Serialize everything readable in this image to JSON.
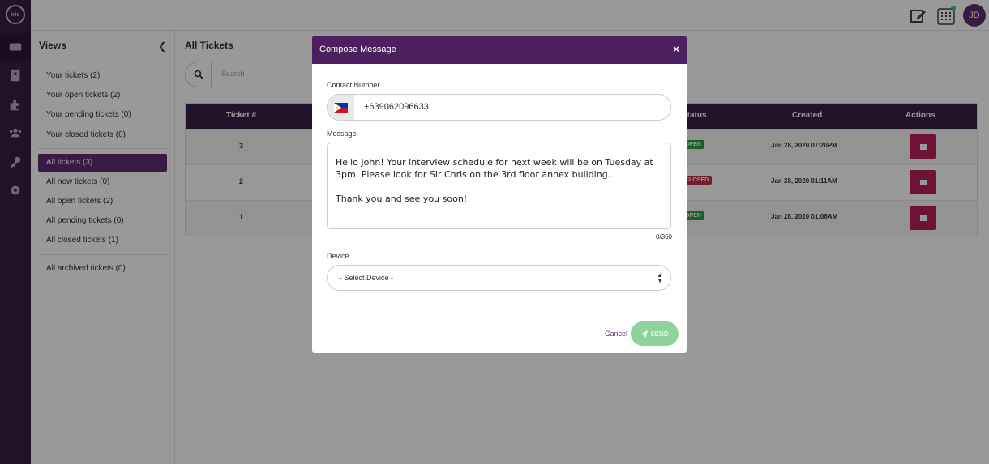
{
  "rail": {
    "logo_text": "iris"
  },
  "topbar": {
    "avatar_initials": "JD"
  },
  "views": {
    "title": "Views",
    "group1": [
      {
        "label": "Your tickets (2)"
      },
      {
        "label": "Your open tickets (2)"
      },
      {
        "label": "Your pending tickets (0)"
      },
      {
        "label": "Your closed tickets (0)"
      }
    ],
    "group2": [
      {
        "label": "All tickets (3)"
      },
      {
        "label": "All new tickets (0)"
      },
      {
        "label": "All open tickets (2)"
      },
      {
        "label": "All pending tickets (0)"
      },
      {
        "label": "All closed tickets (1)"
      }
    ],
    "group3": [
      {
        "label": "All archived tickets (0)"
      }
    ]
  },
  "main": {
    "title": "All Tickets",
    "search_placeholder": "Search",
    "columns": {
      "ticket": "Ticket #",
      "status": "Status",
      "created": "Created",
      "actions": "Actions"
    },
    "rows": [
      {
        "ticket": "3",
        "status": "OPEN",
        "created": "Jan 28, 2020 07:20PM"
      },
      {
        "ticket": "2",
        "status": "CLOSED",
        "created": "Jan 28, 2020 01:11AM"
      },
      {
        "ticket": "1",
        "status": "OPEN",
        "created": "Jan 28, 2020 01:06AM"
      }
    ]
  },
  "modal": {
    "title": "Compose Message",
    "close_label": "×",
    "contact_label": "Contact Number",
    "contact_value": "+639062096633",
    "message_label": "Message",
    "message_text": "Hello John! Your interview schedule for next week will be on Tuesday at 3pm. Please look for Sir Chris on the 3rd floor annex building.\n\nThank you and see you soon!",
    "counter": "0/360",
    "device_label": "Device",
    "device_value": "- Select Device -",
    "cancel_label": "Cancel",
    "send_label": "SEND"
  },
  "colors": {
    "rail": "#3a1f45",
    "modal_header": "#4d1f5f",
    "send_button": "#8fd29a",
    "open_badge": "#2e9e4d",
    "closed_badge": "#c0304d",
    "action_button": "#b7215a"
  }
}
